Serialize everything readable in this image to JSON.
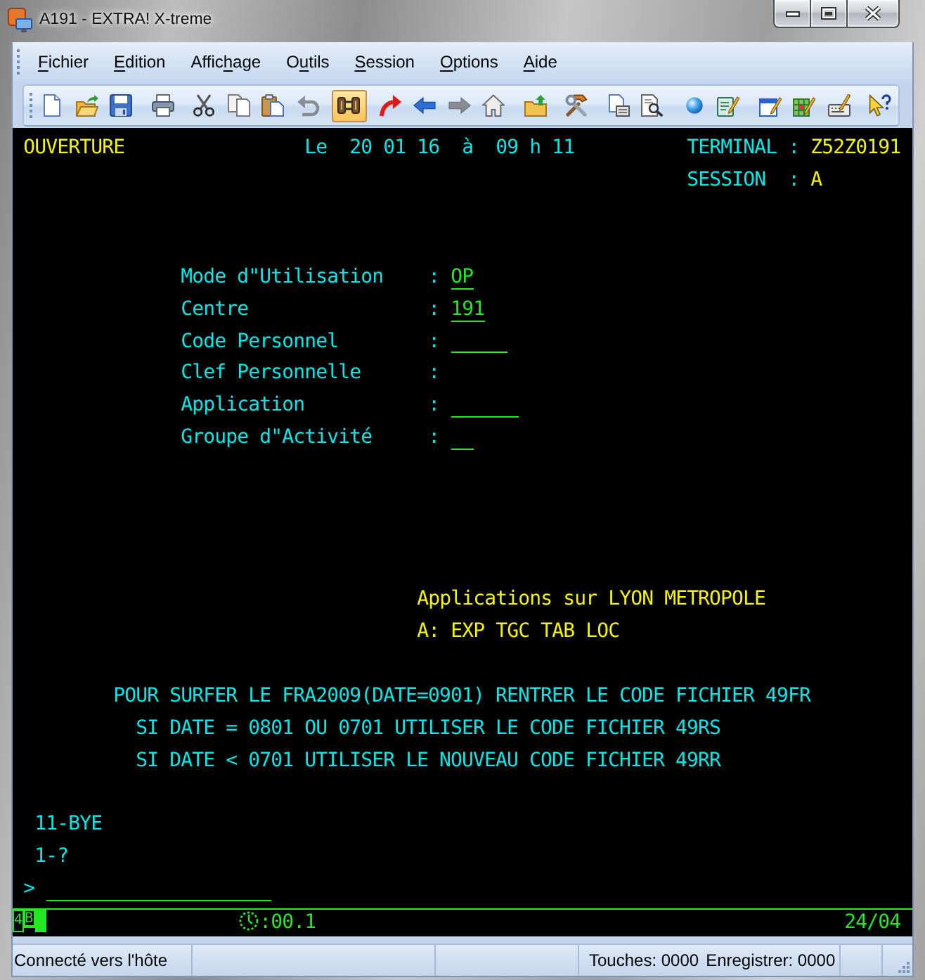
{
  "window": {
    "title": "A191 - EXTRA! X-treme"
  },
  "menu": [
    {
      "parts": [
        {
          "text": "F",
          "underlined": true
        },
        {
          "text": "ichier",
          "underlined": false
        }
      ]
    },
    {
      "parts": [
        {
          "text": "E",
          "underlined": true
        },
        {
          "text": "dition",
          "underlined": false
        }
      ]
    },
    {
      "parts": [
        {
          "text": "Affic",
          "underlined": false
        },
        {
          "text": "h",
          "underlined": true
        },
        {
          "text": "age",
          "underlined": false
        }
      ]
    },
    {
      "parts": [
        {
          "text": "O",
          "underlined": false
        },
        {
          "text": "u",
          "underlined": true
        },
        {
          "text": "tils",
          "underlined": false
        }
      ]
    },
    {
      "parts": [
        {
          "text": "S",
          "underlined": true
        },
        {
          "text": "ession",
          "underlined": false
        }
      ]
    },
    {
      "parts": [
        {
          "text": "O",
          "underlined": true
        },
        {
          "text": "ptions",
          "underlined": false
        }
      ]
    },
    {
      "parts": [
        {
          "text": "A",
          "underlined": true
        },
        {
          "text": "ide",
          "underlined": false
        }
      ]
    }
  ],
  "toolbar": {
    "groups": [
      [
        {
          "kind": "new",
          "pressed": false,
          "disabled": false
        },
        {
          "kind": "open",
          "pressed": false,
          "disabled": false
        },
        {
          "kind": "save",
          "pressed": false,
          "disabled": false
        }
      ],
      [
        {
          "kind": "print",
          "pressed": false,
          "disabled": false
        }
      ],
      [
        {
          "kind": "cut",
          "pressed": false,
          "disabled": false
        },
        {
          "kind": "copy",
          "pressed": false,
          "disabled": false
        },
        {
          "kind": "paste",
          "pressed": false,
          "disabled": false
        },
        {
          "kind": "undo",
          "pressed": false,
          "disabled": true
        }
      ],
      [
        {
          "kind": "connect",
          "pressed": true,
          "disabled": false
        }
      ],
      [
        {
          "kind": "redo",
          "pressed": false,
          "disabled": false
        },
        {
          "kind": "back",
          "pressed": false,
          "disabled": false
        },
        {
          "kind": "forward",
          "pressed": false,
          "disabled": true
        },
        {
          "kind": "home",
          "pressed": false,
          "disabled": false
        }
      ],
      [
        {
          "kind": "transfer",
          "pressed": false,
          "disabled": false
        }
      ],
      [
        {
          "kind": "tools",
          "pressed": false,
          "disabled": false
        }
      ],
      [
        {
          "kind": "document",
          "pressed": false,
          "disabled": false
        },
        {
          "kind": "inspect",
          "pressed": false,
          "disabled": false
        }
      ],
      [
        {
          "kind": "sphere",
          "pressed": false,
          "disabled": false
        },
        {
          "kind": "notepad",
          "pressed": false,
          "disabled": false
        }
      ],
      [
        {
          "kind": "edit",
          "pressed": false,
          "disabled": false
        },
        {
          "kind": "grid",
          "pressed": false,
          "disabled": false
        },
        {
          "kind": "keyboard",
          "pressed": false,
          "disabled": false
        }
      ],
      [
        {
          "kind": "help",
          "pressed": false,
          "disabled": false
        }
      ]
    ]
  },
  "terminal": {
    "header": {
      "screen": "OUVERTURE",
      "datetime": "Le  20 01 16  à  09 h 11",
      "terminal_label": "TERMINAL :",
      "terminal_id": "Z52Z0191",
      "session_label": "SESSION  :",
      "session_id": "A"
    },
    "form": [
      {
        "label": "Mode d\"Utilisation",
        "separator": ":",
        "kind": "filled",
        "value": "OP"
      },
      {
        "label": "Centre",
        "separator": ":",
        "kind": "filled",
        "value": "191"
      },
      {
        "label": "Code Personnel",
        "separator": ":",
        "kind": "blank"
      },
      {
        "label": "Clef Personnelle",
        "separator": ":",
        "kind": "hidden"
      },
      {
        "label": "Application",
        "separator": ":",
        "kind": "blank"
      },
      {
        "label": "Groupe d\"Activité",
        "separator": ":",
        "kind": "blank"
      }
    ],
    "applications": {
      "title": "Applications sur LYON METROPOLE",
      "codes": "A: EXP TGC TAB LOC"
    },
    "notices": [
      "POUR SURFER LE FRA2009(DATE=0901) RENTRER LE CODE FICHIER 49FR",
      "SI DATE = 0801 OU 0701 UTILISER LE CODE FICHIER 49RS",
      "SI DATE < 0701 UTILISER LE NOUVEAU CODE FICHIER 49RR"
    ],
    "commands": [
      "11-BYE",
      "1-?"
    ],
    "prompt": {
      "symbol": ">"
    },
    "oia": {
      "flags": [
        "4",
        "B"
      ],
      "timer": ":00.1",
      "cursor": "24/04"
    }
  },
  "status_bar": {
    "message": "Connecté vers l'hôte",
    "keys": "Touches: 0000",
    "record": "Enregistrer: 0000"
  }
}
